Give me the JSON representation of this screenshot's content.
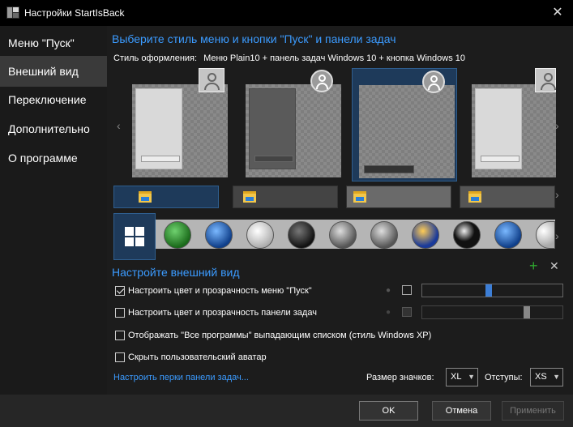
{
  "window": {
    "title": "Настройки StartIsBack",
    "icon_name": "startisback-app-icon",
    "close_symbol": "✕"
  },
  "sidebar": {
    "items": [
      {
        "label": "Меню \"Пуск\"",
        "selected": false
      },
      {
        "label": "Внешний вид",
        "selected": true
      },
      {
        "label": "Переключение",
        "selected": false
      },
      {
        "label": "Дополнительно",
        "selected": false
      },
      {
        "label": "О программе",
        "selected": false
      }
    ]
  },
  "style_section": {
    "heading": "Выберите стиль меню и кнопки \"Пуск\" и панели задач",
    "style_label": "Стиль оформления:",
    "style_value": "Меню Plain10 + панель задач Windows 10 + кнопка Windows 10",
    "selected_style_index": 2,
    "selected_orb_index": 0,
    "nav_left": "‹",
    "nav_right": "›"
  },
  "appearance_section": {
    "heading": "Настройте внешний вид",
    "add_symbol": "+",
    "remove_symbol": "✕",
    "options": [
      {
        "label": "Настроить цвет и прозрачность меню \"Пуск\"",
        "checked": true
      },
      {
        "label": "Настроить цвет и прозрачность панели задач",
        "checked": false
      },
      {
        "label": "Отображать \"Все программы\" выпадающим списком (стиль Windows XP)",
        "checked": false
      },
      {
        "label": "Скрыть пользовательский аватар",
        "checked": false
      }
    ],
    "menu_transparency": 0.47,
    "taskbar_transparency": 0.76,
    "taskbar_link": "Настроить перки панели задач...",
    "icon_size_label": "Размер значков:",
    "icon_size_value": "XL",
    "padding_label": "Отступы:",
    "padding_value": "XS"
  },
  "buttons": {
    "ok": "OK",
    "cancel": "Отмена",
    "apply": "Применить"
  },
  "colors": {
    "accent": "#3b9bff",
    "selection": "#1e3a5a",
    "slider_thumb": "#3c7ed6"
  }
}
